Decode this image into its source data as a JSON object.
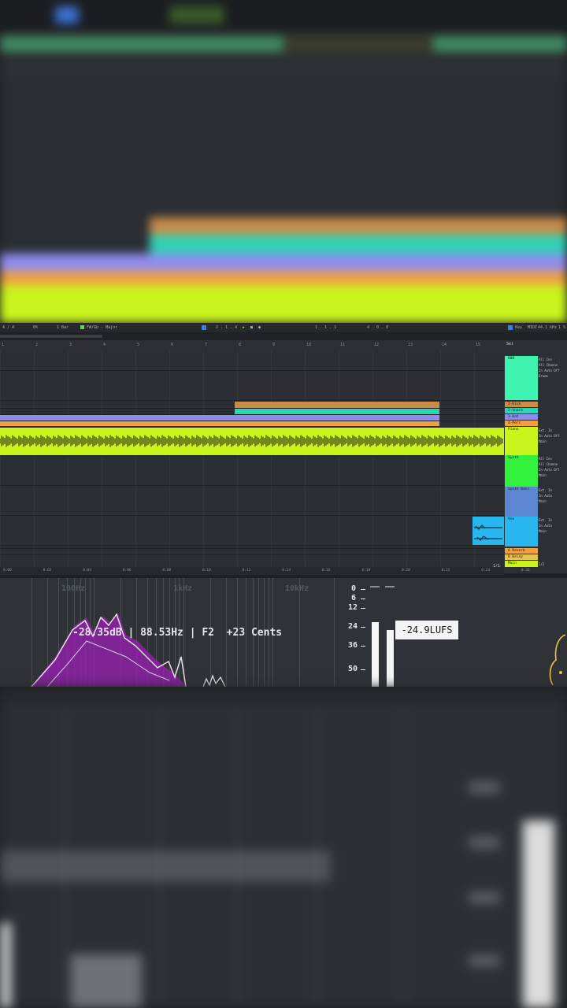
{
  "toolbar": {
    "meter": "4 / 4",
    "zoom": "0%",
    "quant": "1 Bar",
    "scale": "F#/Gb - Major",
    "pos1": "2 . 1 . 4",
    "pos2": "1 . 1 . 1",
    "pos3": "4 . 0 . 0",
    "key": "Key",
    "midi": "MIDI",
    "rate": "44.1 kHz",
    "cpu": "1 %"
  },
  "ruler": [
    "1",
    "2",
    "3",
    "4",
    "5",
    "6",
    "7",
    "8",
    "9",
    "10",
    "11",
    "12",
    "13",
    "14",
    "15",
    "16"
  ],
  "timeline": [
    "0:00",
    "0:02",
    "0:04",
    "0:06",
    "0:08",
    "0:10",
    "0:12",
    "0:14",
    "0:16",
    "0:18",
    "0:20",
    "0:22",
    "0:24",
    "0:26"
  ],
  "tracks": [
    {
      "name": "808",
      "color": "#3df5b0",
      "io": [
        "All Ins",
        "All Channe",
        "In Auto Off",
        "Drums"
      ]
    },
    {
      "name": "1-Kick",
      "color": "#c98b4a",
      "io": []
    },
    {
      "name": "2-Snare",
      "color": "#2fd3b4",
      "io": []
    },
    {
      "name": "3-Hat",
      "color": "#8f8cf0",
      "io": []
    },
    {
      "name": "4-Perc",
      "color": "#f0a040",
      "io": []
    },
    {
      "name": "Piano",
      "color": "#c9f51d",
      "io": [
        "Ext. In",
        "In Auto Off",
        "Main"
      ]
    },
    {
      "name": "Synth",
      "color": "#32f23e",
      "io": [
        "All Ins",
        "All Channe",
        "In Auto Off",
        "Main"
      ]
    },
    {
      "name": "Synth Bass",
      "color": "#5d86d0",
      "io": [
        "Ext. In",
        "In Auto",
        "Main"
      ]
    },
    {
      "name": "Vox",
      "color": "#29b5ee",
      "io": [
        "Ext. In",
        "In Auto",
        "Main"
      ]
    },
    {
      "name": "A Reverb",
      "color": "#f0a040",
      "io": []
    },
    {
      "name": "B Delay",
      "color": "#e8c24a",
      "io": []
    },
    {
      "name": "Main",
      "color": "#c9f51d",
      "io": [
        "1/2"
      ]
    }
  ],
  "set_label": "Set",
  "page_indicator": "1/1",
  "analyzer": {
    "freq_labels": [
      "100Hz",
      "1kHz",
      "10kHz"
    ],
    "readout": "-28.35dB | 88.53Hz | F2  +23 Cents",
    "db_scale": [
      "0",
      "6",
      "12",
      "24",
      "36",
      "50"
    ],
    "lufs": "-24.9LUFS"
  },
  "colors": {
    "lime": "#c9f51d",
    "orange": "#f0a040",
    "purple": "#8f8cf0",
    "teal": "#2fd3b4",
    "brown": "#c98b4a",
    "spectrum": "#9b1fb5"
  }
}
